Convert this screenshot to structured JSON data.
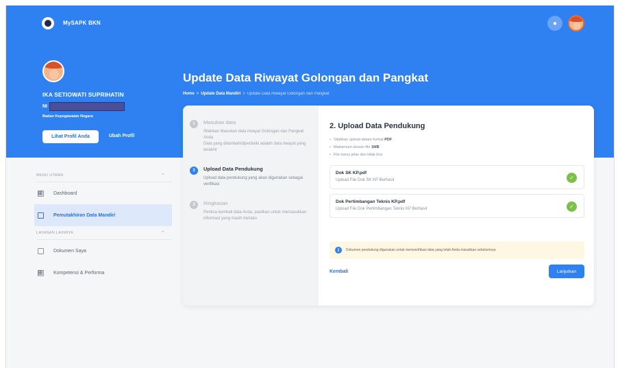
{
  "header": {
    "app_name": "MySAPK BKN"
  },
  "profile": {
    "name": "IKA SETIOWATI SUPRIHATIN",
    "nip_label": "NI",
    "agency": "Badan Kepegawaian Negara",
    "view_profile_label": "Lihat Profil Anda",
    "edit_profile_label": "Ubah Profil"
  },
  "page": {
    "title": "Update Data Riwayat Golongan dan Pangkat",
    "breadcrumb": [
      "Home",
      ">",
      "Update Data Mandiri",
      ">",
      "Update Data Riwayat Golongan dan Pangkat"
    ]
  },
  "sidebar": {
    "sections": [
      {
        "label": "MENU UTAMA",
        "items": [
          {
            "label": "Dashboard",
            "active": false
          },
          {
            "label": "Pemutakhiran Data Mandiri",
            "active": true
          }
        ]
      },
      {
        "label": "LAYANAN LAINNYA",
        "items": [
          {
            "label": "Dokumen Saya",
            "active": false
          },
          {
            "label": "Kompetensi & Performa",
            "active": false
          }
        ]
      }
    ]
  },
  "steps": [
    {
      "num": "1",
      "title": "Masukan data",
      "desc": "Silahkan Masukan data riwayat Golongan dan Pangkat Anda\nData yang ditambah/diperbaiki adalah data riwayat yang terakhir"
    },
    {
      "num": "2",
      "title": "Upload Data Pendukung",
      "desc": "Upload data pendukung yang akan digunakan sebagai verifikasi"
    },
    {
      "num": "3",
      "title": "Ringkasan",
      "desc": "Periksa kembali data Anda, pastikan untuk memasukkan informasi yang masih berlaku"
    }
  ],
  "upload": {
    "title": "2. Upload Data Pendukung",
    "rules": [
      {
        "text": "Silahkan upload dalam format ",
        "bold": "PDF"
      },
      {
        "text": "Maksimum ukuran file ",
        "bold": "1MB"
      },
      {
        "text": "File harus jelas dan tidak blur",
        "bold": ""
      }
    ],
    "files": [
      {
        "name": "Dok SK KP.pdf",
        "status": "Upload File Dok SK KP Berhasil"
      },
      {
        "name": "Dok Pertimbangan Teknis KP.pdf",
        "status": "Upload File Dok Pertimbangan Teknis KP Berhasil"
      }
    ],
    "notice": "Dokumen pendukung digunakan untuk memverifikasi data yang telah Anda masukkan sebelumnya",
    "back_label": "Kembali",
    "next_label": "Lanjutkan"
  },
  "colors": {
    "primary": "#2f80f0",
    "success": "#7cc04b",
    "notice_bg": "#fdf7e3"
  }
}
